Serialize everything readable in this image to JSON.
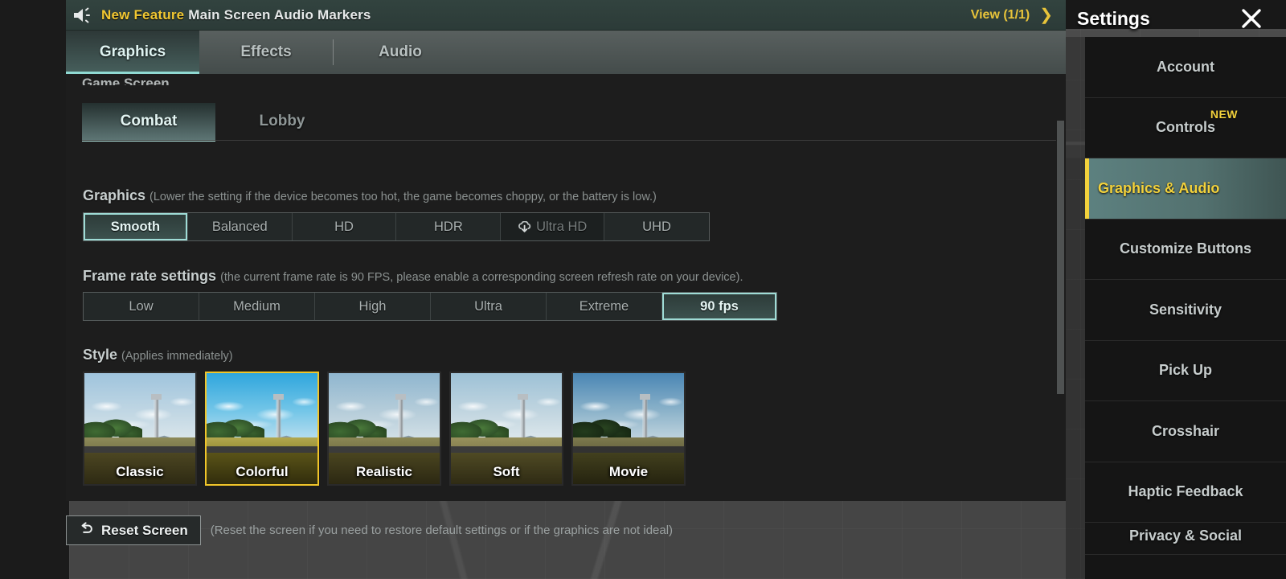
{
  "banner": {
    "speaker_icon": "speaker-icon",
    "new_feature_label": "New Feature",
    "title": "Main Screen Audio Markers",
    "view_label": "View (1/1)",
    "arrow_icon": "chevron-right-icon",
    "accent_color": "#e8c43a"
  },
  "top_tabs": [
    {
      "label": "Graphics",
      "selected": true
    },
    {
      "label": "Effects",
      "selected": false
    },
    {
      "label": "Audio",
      "selected": false
    }
  ],
  "panel": {
    "clipped_header": "Game Screen",
    "sub_tabs": [
      {
        "label": "Combat",
        "selected": true
      },
      {
        "label": "Lobby",
        "selected": false
      }
    ],
    "graphics": {
      "heading": "Graphics",
      "hint": "(Lower the setting if the device becomes too hot, the game becomes choppy, or the battery is low.)",
      "options": [
        {
          "label": "Smooth",
          "selected": true,
          "dimmed": false,
          "icon": null
        },
        {
          "label": "Balanced",
          "selected": false,
          "dimmed": false,
          "icon": null
        },
        {
          "label": "HD",
          "selected": false,
          "dimmed": false,
          "icon": null
        },
        {
          "label": "HDR",
          "selected": false,
          "dimmed": false,
          "icon": null
        },
        {
          "label": "Ultra HD",
          "selected": false,
          "dimmed": true,
          "icon": "cloud-download-icon"
        },
        {
          "label": "UHD",
          "selected": false,
          "dimmed": false,
          "icon": null
        }
      ]
    },
    "frame_rate": {
      "heading": "Frame rate settings",
      "hint": "(the current frame rate is 90 FPS, please enable a corresponding screen refresh rate on your device).",
      "options": [
        {
          "label": "Low",
          "selected": false
        },
        {
          "label": "Medium",
          "selected": false
        },
        {
          "label": "High",
          "selected": false
        },
        {
          "label": "Ultra",
          "selected": false
        },
        {
          "label": "Extreme",
          "selected": false
        },
        {
          "label": "90 fps",
          "selected": true
        }
      ]
    },
    "style": {
      "heading": "Style",
      "hint": "(Applies immediately)",
      "items": [
        {
          "label": "Classic",
          "selected": false
        },
        {
          "label": "Colorful",
          "selected": true
        },
        {
          "label": "Realistic",
          "selected": false
        },
        {
          "label": "Soft",
          "selected": false
        },
        {
          "label": "Movie",
          "selected": false
        }
      ]
    },
    "reset": {
      "icon": "undo-arrow-icon",
      "label": "Reset Screen",
      "note": "(Reset the screen if you need to restore default settings or if the graphics are not ideal)"
    }
  },
  "sidebar": {
    "title": "Settings",
    "close_icon": "close-icon",
    "items": [
      {
        "label": "Account",
        "selected": false,
        "badge": null
      },
      {
        "label": "Controls",
        "selected": false,
        "badge": "NEW"
      },
      {
        "label": "Graphics & Audio",
        "selected": true,
        "badge": null
      },
      {
        "label": "Customize Buttons",
        "selected": false,
        "badge": null
      },
      {
        "label": "Sensitivity",
        "selected": false,
        "badge": null
      },
      {
        "label": "Pick Up",
        "selected": false,
        "badge": null
      },
      {
        "label": "Crosshair",
        "selected": false,
        "badge": null
      },
      {
        "label": "Haptic Feedback",
        "selected": false,
        "badge": null
      },
      {
        "label": "Privacy & Social",
        "selected": false,
        "badge": null
      }
    ],
    "highlight_color": "#f3d23c"
  }
}
